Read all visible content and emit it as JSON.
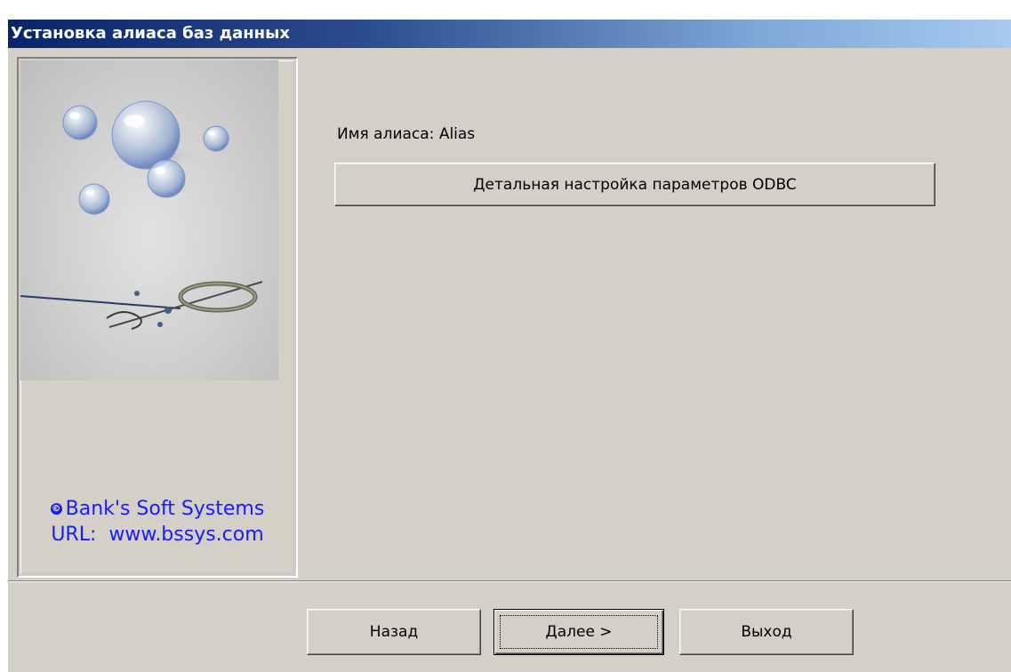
{
  "window": {
    "title": "Установка алиаса баз данных"
  },
  "left_panel": {
    "copyright_line1": "Bank's Soft Systems",
    "copyright_symbol": "©",
    "copyright_line2": "URL:  www.bssys.com"
  },
  "main": {
    "alias_label": "Имя алиаса: Alias",
    "odbc_button_label": "Детальная настройка параметров ODBC"
  },
  "footer": {
    "back_label": "Назад",
    "next_label": "Далее >",
    "exit_label": "Выход"
  },
  "colors": {
    "titlebar_start": "#0a246a",
    "titlebar_end": "#a6caf0",
    "face": "#d4d0c8",
    "link_blue": "#1a1aff"
  }
}
